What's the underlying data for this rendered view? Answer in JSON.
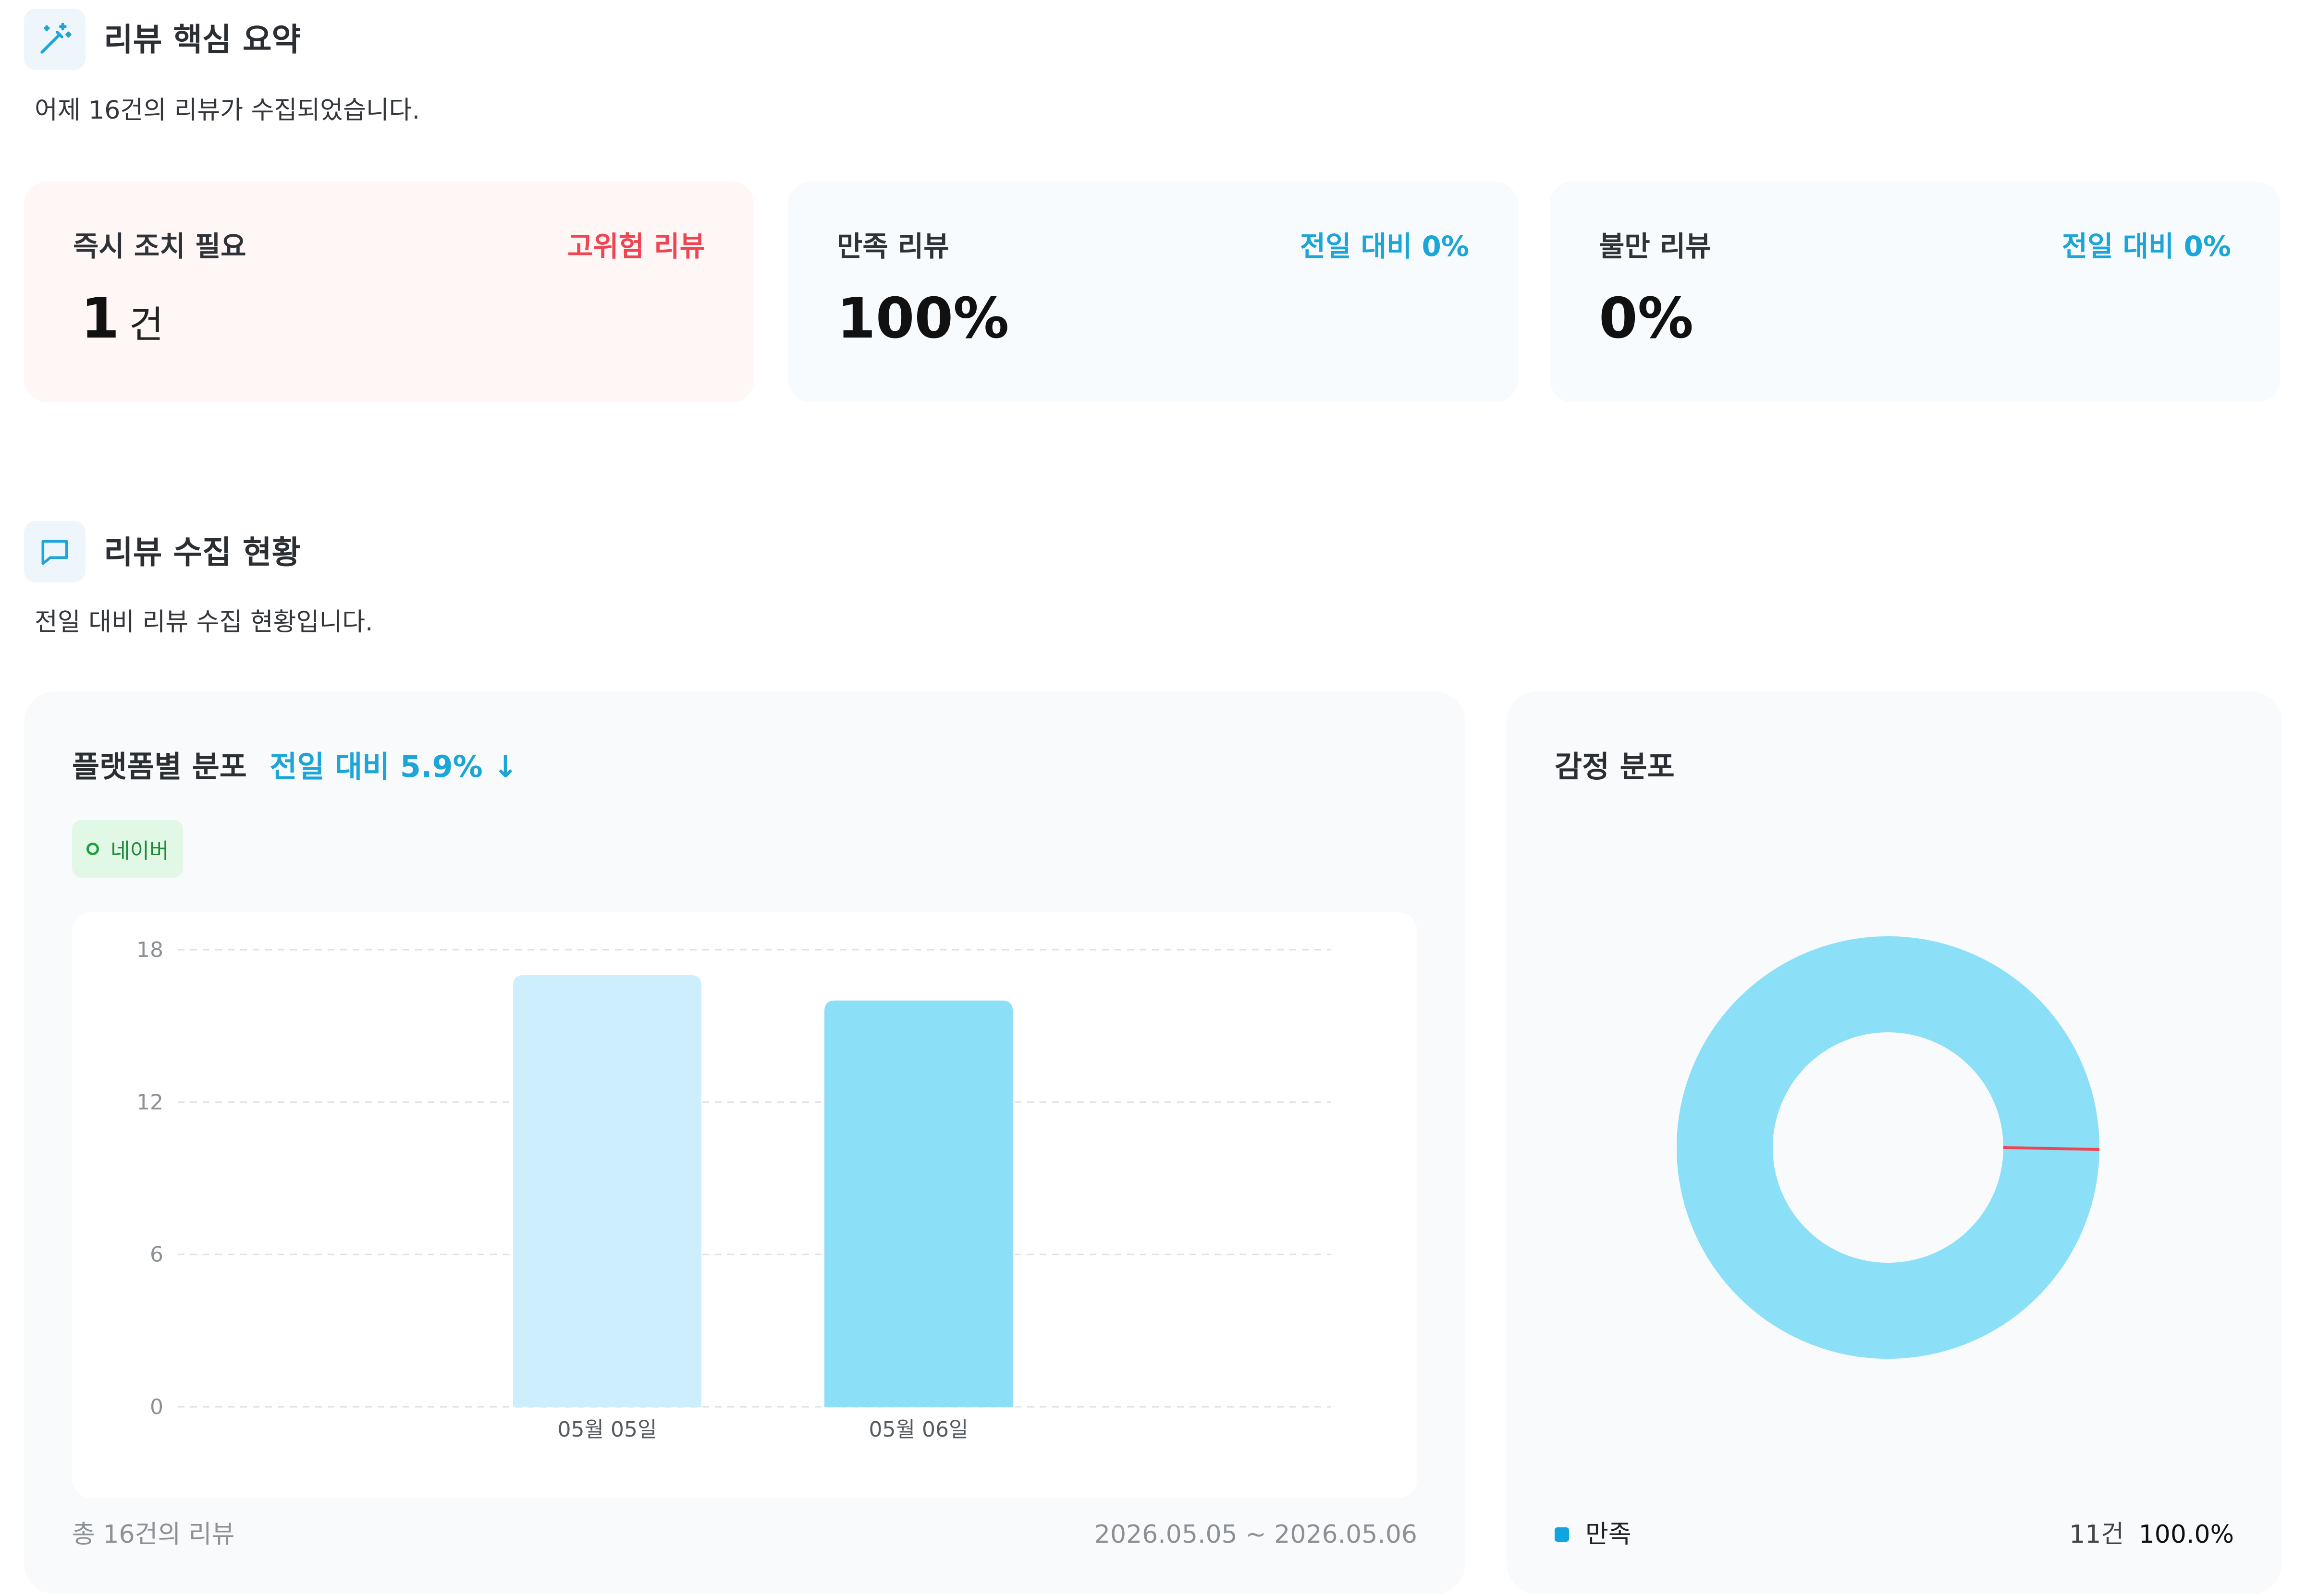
{
  "summary": {
    "title": "리뷰 핵심 요약",
    "description": "어제 16건의 리뷰가 수집되었습니다.",
    "cards": [
      {
        "label": "즉시 조치 필요",
        "tag": "고위험 리뷰",
        "value": "1",
        "unit": "건"
      },
      {
        "label": "만족 리뷰",
        "tag": "전일 대비 0%",
        "value": "100%"
      },
      {
        "label": "불만 리뷰",
        "tag": "전일 대비 0%",
        "value": "0%"
      }
    ]
  },
  "collection": {
    "title": "리뷰 수집 현황",
    "description": "전일 대비 리뷰 수집 현황입니다."
  },
  "platform": {
    "title": "플랫폼별 분포",
    "change": "전일 대비 5.9% ↓",
    "chip": "네이버",
    "total": "총 16건의 리뷰",
    "range": "2026.05.05 ~ 2026.05.06"
  },
  "sentiment": {
    "title": "감정 분포",
    "legend": {
      "label": "만족",
      "count": "11건",
      "percent": "100.0%"
    }
  },
  "colors": {
    "accent": "#1ba5d8",
    "danger": "#ef4452",
    "bar_prev": "#cdeffd",
    "bar_curr": "#8bdff7",
    "donut": "#8bdff7",
    "legend_dot": "#0ea5e0"
  },
  "chart_data": [
    {
      "type": "bar",
      "categories": [
        "05월 05일",
        "05월 06일"
      ],
      "values": [
        17,
        16
      ],
      "yticks": [
        0,
        6,
        12,
        18
      ],
      "ylim": [
        0,
        18
      ],
      "grid": true
    },
    {
      "type": "pie",
      "labels": [
        "만족"
      ],
      "values": [
        100.0
      ],
      "donut": true
    }
  ]
}
